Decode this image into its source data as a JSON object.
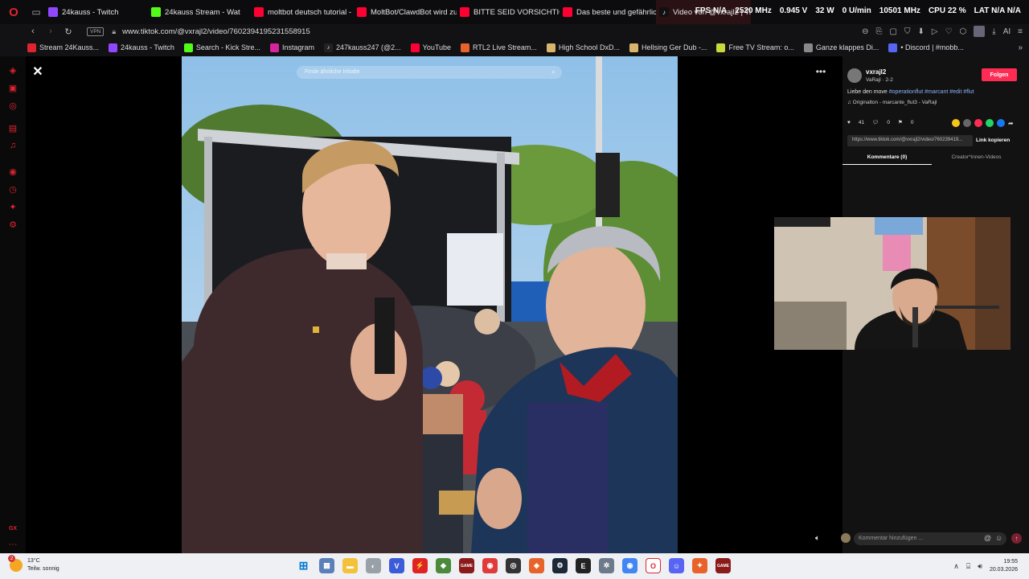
{
  "tabbar": {
    "tabs": [
      {
        "label": "24kauss - Twitch",
        "icon": "twitch-icon"
      },
      {
        "label": "24kauss Stream - Wat",
        "icon": "kick-icon"
      },
      {
        "label": "moltbot deutsch tutorial -",
        "icon": "youtube-icon"
      },
      {
        "label": "MoltBot/ClawdBot wird zu",
        "icon": "youtube-icon"
      },
      {
        "label": "BITTE SEID VORSICHTIG",
        "icon": "youtube-icon"
      },
      {
        "label": "Das beste und gefährlichs",
        "icon": "youtube-icon"
      },
      {
        "label": "Video von @vxrajl2 | TikTo",
        "icon": "tiktok-icon",
        "active": true
      }
    ]
  },
  "overlay": {
    "fps": "FPS",
    "fps_val": "N/A",
    "gpu_mhz": "2520 MHz",
    "volt": "0.945 V",
    "watt": "32 W",
    "fan": "0 U/min",
    "mem": "10501 MHz",
    "cpu": "CPU",
    "cpu_val": "22 %",
    "lat": "LAT",
    "lat_val": "N/A",
    "lat_val2": "N/A"
  },
  "addressbar": {
    "vpn": "VPN",
    "url": "www.tiktok.com/@vxrajl2/video/7602394195231558915"
  },
  "bookmarks": [
    {
      "label": "Stream 24Kauss...",
      "color": "#e0242f"
    },
    {
      "label": "24kauss - Twitch",
      "color": "#9147ff"
    },
    {
      "label": "Search - Kick Stre...",
      "color": "#53fc18"
    },
    {
      "label": "Instagram",
      "color": "#d6249f"
    },
    {
      "label": "247kauss247 (@2...",
      "color": "#222222"
    },
    {
      "label": "YouTube",
      "color": "#ff0033"
    },
    {
      "label": "RTL2 Live Stream...",
      "color": "#e8632b"
    },
    {
      "label": "High School DxD...",
      "color": "#d8b56a"
    },
    {
      "label": "Hellsing Ger Dub -...",
      "color": "#d8b56a"
    },
    {
      "label": "Free TV Stream: o...",
      "color": "#c7d93b"
    },
    {
      "label": "Ganze klappes Di...",
      "color": "#888888"
    },
    {
      "label": "• Discord | #mobb...",
      "color": "#5865f2"
    }
  ],
  "video": {
    "search_placeholder": "Finde ähnliche Inhalte"
  },
  "panel": {
    "username": "vxrajl2",
    "subline": "VaRajl · 2-2",
    "follow": "Folgen",
    "caption_prefix": "Liebe den move ",
    "hashtags": "#operationflut #marcant #edit #flut",
    "sound": "♫ Originalton - marcante_flut3 - VaRajl",
    "likes": "41",
    "comments": "0",
    "saves": "0",
    "link": "https://www.tiktok.com/@vxrajl2/video/760239419...",
    "copy_link": "Link kopieren",
    "tab_comments": "Kommentare (0)",
    "tab_creator": "Creator*innen-Videos",
    "comment_placeholder": "Kommentar hinzufügen ..."
  },
  "taskbar": {
    "temp": "13°C",
    "weather": "Teilw. sonnig",
    "badge": "2",
    "time": "19:55",
    "date": "20.03.2026"
  }
}
